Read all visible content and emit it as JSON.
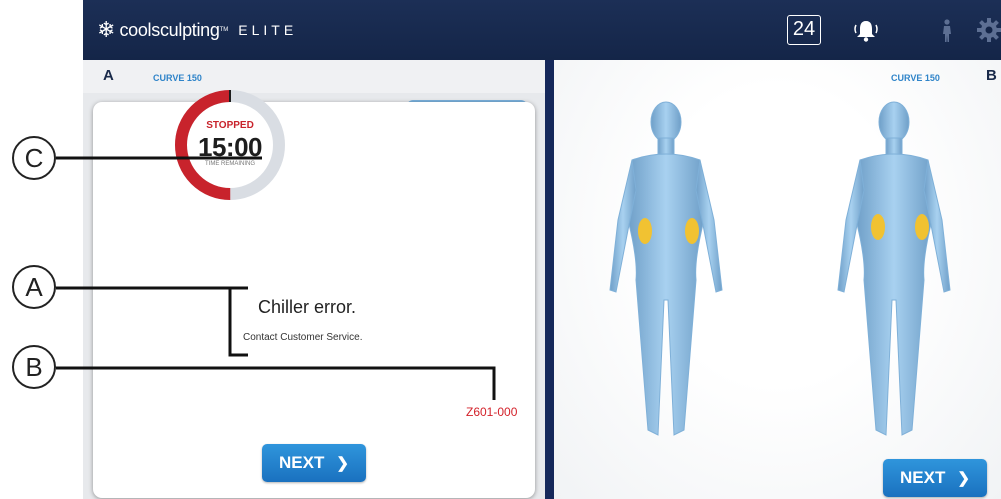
{
  "header": {
    "brand_name": "coolsculpting",
    "brand_tm": "TM",
    "brand_suffix": "ELITE",
    "counter": "24",
    "icons": [
      "snowflake-icon",
      "bell-icon",
      "person-icon",
      "gear-icon"
    ]
  },
  "panel_a": {
    "letter": "A",
    "curve": "CURVE 150",
    "timer": {
      "status": "STOPPED",
      "time": "15:00",
      "caption": "TIME REMAINING",
      "progress_fraction": 0.5
    },
    "error_title": "Chiller error.",
    "error_detail": "Contact Customer Service.",
    "error_code": "Z601-000",
    "next_label": "NEXT"
  },
  "panel_b": {
    "letter": "B",
    "curve": "CURVE 150",
    "next_label": "NEXT"
  },
  "callouts": {
    "c": "C",
    "a": "A",
    "b": "B"
  },
  "colors": {
    "header_bg": "#142548",
    "accent_blue": "#2f84c9",
    "button_blue": "#1a71bf",
    "error_red": "#c8232c",
    "applicator_yellow": "#f1c232"
  }
}
